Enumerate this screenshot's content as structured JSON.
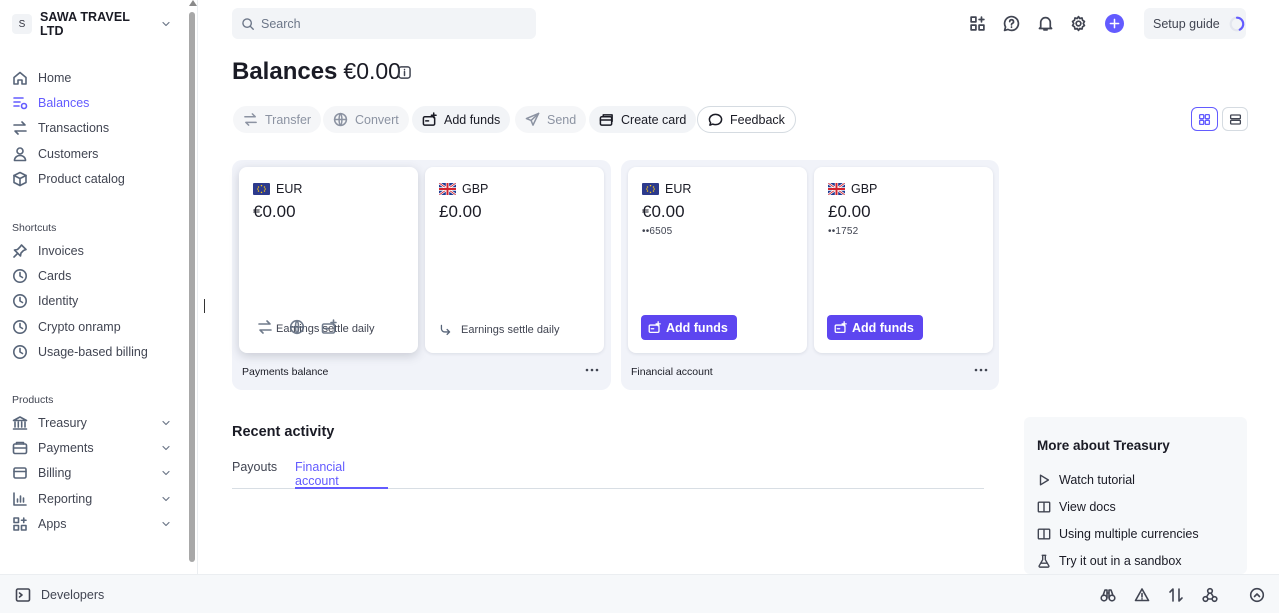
{
  "account": {
    "initial": "S",
    "name": "SAWA TRAVEL LTD"
  },
  "nav": {
    "main": [
      {
        "label": "Home",
        "icon": "home-icon"
      },
      {
        "label": "Balances",
        "icon": "balances-icon",
        "active": true
      },
      {
        "label": "Transactions",
        "icon": "transactions-icon"
      },
      {
        "label": "Customers",
        "icon": "customers-icon"
      },
      {
        "label": "Product catalog",
        "icon": "product-catalog-icon"
      }
    ],
    "shortcuts_label": "Shortcuts",
    "shortcuts": [
      {
        "label": "Invoices",
        "icon": "invoices-icon"
      },
      {
        "label": "Cards",
        "icon": "cards-icon"
      },
      {
        "label": "Identity",
        "icon": "identity-icon"
      },
      {
        "label": "Crypto onramp",
        "icon": "crypto-onramp-icon"
      },
      {
        "label": "Usage-based billing",
        "icon": "usage-billing-icon"
      }
    ],
    "products_label": "Products",
    "products": [
      {
        "label": "Treasury",
        "icon": "treasury-icon"
      },
      {
        "label": "Payments",
        "icon": "payments-icon"
      },
      {
        "label": "Billing",
        "icon": "billing-icon"
      },
      {
        "label": "Reporting",
        "icon": "reporting-icon"
      },
      {
        "label": "Apps",
        "icon": "apps-icon"
      }
    ]
  },
  "bottom": {
    "developers_label": "Developers"
  },
  "search": {
    "placeholder": "Search"
  },
  "header": {
    "setup_guide_label": "Setup guide",
    "accent_color": "#635bff"
  },
  "page": {
    "title": "Balances",
    "total": "€0.00"
  },
  "actions": {
    "transfer": "Transfer",
    "convert": "Convert",
    "add_funds": "Add funds",
    "send": "Send",
    "create_card": "Create card",
    "feedback": "Feedback"
  },
  "payments_balance": {
    "label": "Payments balance",
    "cards": [
      {
        "currency": "EUR",
        "amount": "€0.00",
        "settle": "Earnings settle daily"
      },
      {
        "currency": "GBP",
        "amount": "£0.00",
        "settle": "Earnings settle daily"
      }
    ]
  },
  "financial_account": {
    "label": "Financial account",
    "cards": [
      {
        "currency": "EUR",
        "amount": "€0.00",
        "account": "••6505",
        "button": "Add funds"
      },
      {
        "currency": "GBP",
        "amount": "£0.00",
        "account": "••1752",
        "button": "Add funds"
      }
    ]
  },
  "recent_activity": {
    "title": "Recent activity",
    "tabs": [
      {
        "label": "Payouts"
      },
      {
        "label": "Financial account",
        "active": true
      }
    ]
  },
  "more_treasury": {
    "title": "More about Treasury",
    "links": [
      {
        "label": "Watch tutorial",
        "icon": "play-icon"
      },
      {
        "label": "View docs",
        "icon": "book-icon"
      },
      {
        "label": "Using multiple currencies",
        "icon": "book-icon"
      },
      {
        "label": "Try it out in a sandbox",
        "icon": "flask-icon"
      }
    ]
  }
}
